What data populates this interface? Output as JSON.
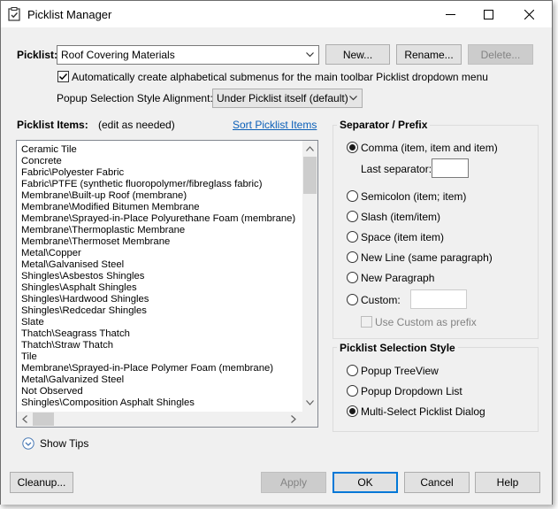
{
  "window": {
    "title": "Picklist Manager"
  },
  "picklist": {
    "label": "Picklist:",
    "selected": "Roof Covering Materials",
    "new_button": "New...",
    "rename_button": "Rename...",
    "delete_button": "Delete..."
  },
  "auto_submenus": {
    "label": "Automatically create alphabetical submenus for the main toolbar Picklist dropdown menu",
    "checked": true
  },
  "popup_alignment": {
    "label": "Popup Selection Style Alignment:",
    "selected": "Under Picklist itself (default)"
  },
  "items_panel": {
    "label": "Picklist Items:",
    "hint": "(edit as needed)",
    "sort_link": "Sort Picklist Items",
    "items": [
      "Ceramic Tile",
      "Concrete",
      "Fabric\\Polyester Fabric",
      "Fabric\\PTFE (synthetic fluoropolymer/fibreglass fabric)",
      "Membrane\\Built-up Roof (membrane)",
      "Membrane\\Modified Bitumen Membrane",
      "Membrane\\Sprayed-in-Place Polyurethane Foam (membrane)",
      "Membrane\\Thermoplastic Membrane",
      "Membrane\\Thermoset Membrane",
      "Metal\\Copper",
      "Metal\\Galvanised Steel",
      "Shingles\\Asbestos Shingles",
      "Shingles\\Asphalt Shingles",
      "Shingles\\Hardwood Shingles",
      "Shingles\\Redcedar Shingles",
      "Slate",
      "Thatch\\Seagrass Thatch",
      "Thatch\\Straw Thatch",
      "Tile",
      "Membrane\\Sprayed-in-Place Polymer Foam (membrane)",
      "Metal\\Galvanized Steel",
      "Not Observed",
      "Shingles\\Composition Asphalt Shingles"
    ]
  },
  "separator": {
    "title": "Separator / Prefix",
    "options": [
      {
        "label": "Comma (item, item and item)",
        "checked": true
      },
      {
        "label": "Semicolon (item; item)",
        "checked": false
      },
      {
        "label": "Slash (item/item)",
        "checked": false
      },
      {
        "label": "Space (item item)",
        "checked": false
      },
      {
        "label": "New Line (same paragraph)",
        "checked": false
      },
      {
        "label": "New Paragraph",
        "checked": false
      },
      {
        "label": "Custom:",
        "checked": false
      }
    ],
    "last_separator_label": "Last separator:",
    "last_separator_value": "",
    "custom_value": "",
    "use_custom_prefix_label": "Use Custom as prefix"
  },
  "selection_style": {
    "title": "Picklist Selection Style",
    "options": [
      {
        "label": "Popup TreeView",
        "checked": false
      },
      {
        "label": "Popup Dropdown List",
        "checked": false
      },
      {
        "label": "Multi-Select Picklist Dialog",
        "checked": true
      }
    ]
  },
  "tips": {
    "label": "Show Tips"
  },
  "footer": {
    "cleanup": "Cleanup...",
    "apply": "Apply",
    "ok": "OK",
    "cancel": "Cancel",
    "help": "Help"
  },
  "colors": {
    "accent": "#0078d7",
    "link": "#0b5fb8",
    "dialog_bg": "#f0f0f0"
  }
}
